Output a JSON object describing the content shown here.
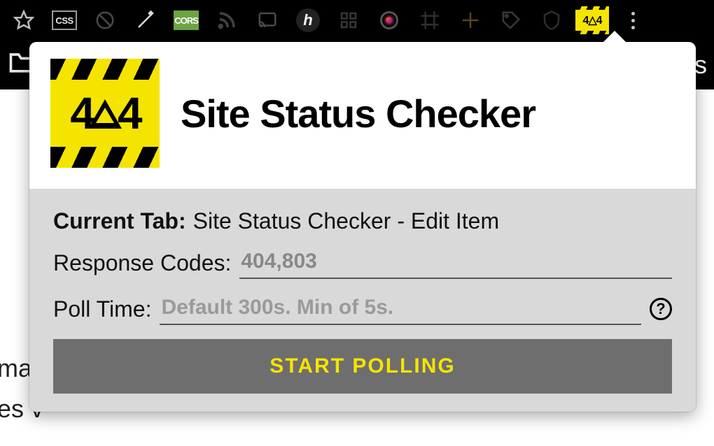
{
  "toolbar": {
    "icons": [
      {
        "name": "star-icon"
      },
      {
        "name": "css-badge",
        "label": "CSS"
      },
      {
        "name": "block-icon"
      },
      {
        "name": "wand-icon"
      },
      {
        "name": "cors-badge",
        "label": "CORS"
      },
      {
        "name": "rss-icon"
      },
      {
        "name": "cast-icon"
      },
      {
        "name": "honey-icon",
        "label": "h"
      },
      {
        "name": "grid-icon"
      },
      {
        "name": "camera-icon"
      },
      {
        "name": "frame-icon"
      },
      {
        "name": "cross-icon"
      },
      {
        "name": "tag-icon"
      },
      {
        "name": "shield-icon"
      },
      {
        "name": "site-status-extension-icon",
        "label": "4△4"
      },
      {
        "name": "more-icon"
      }
    ],
    "bookmarks_text": "ks"
  },
  "popup": {
    "title": "Site Status Checker",
    "logo_text": "4△4",
    "current_tab_label": "Current Tab:",
    "current_tab_value": "Site Status Checker - Edit Item",
    "response_codes_label": "Response Codes:",
    "response_codes_value": "404,803",
    "poll_time_label": "Poll Time:",
    "poll_time_placeholder": "Default 300s. Min of 5s.",
    "help_label": "?",
    "start_button_label": "START POLLING"
  },
  "background": {
    "line1": "mag",
    "line2": "es v"
  }
}
